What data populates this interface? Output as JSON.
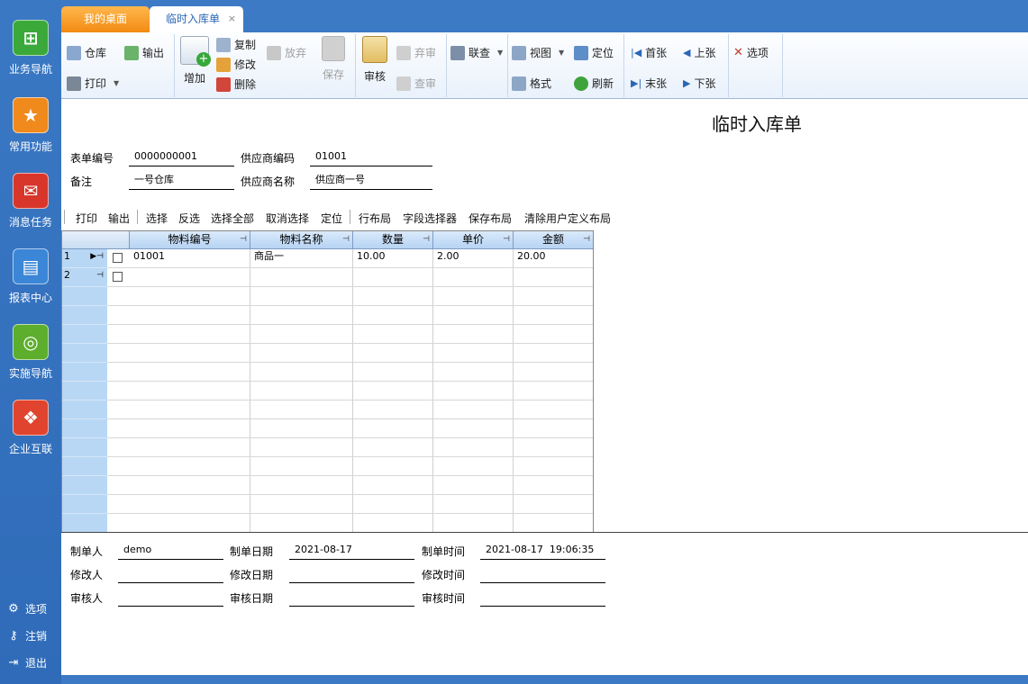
{
  "sidebar": {
    "items": [
      {
        "label": "业务导航",
        "icon": "business-nav-icon",
        "color": "#3aa93a"
      },
      {
        "label": "常用功能",
        "icon": "star-icon",
        "color": "#f08a1c"
      },
      {
        "label": "消息任务",
        "icon": "message-icon",
        "color": "#d9362b"
      },
      {
        "label": "报表中心",
        "icon": "report-icon",
        "color": "#3b86d6"
      },
      {
        "label": "实施导航",
        "icon": "compass-icon",
        "color": "#5cae2c"
      },
      {
        "label": "企业互联",
        "icon": "enterprise-icon",
        "color": "#e0442e"
      }
    ],
    "bottom": [
      {
        "label": "选项",
        "icon": "gear-icon"
      },
      {
        "label": "注销",
        "icon": "key-icon"
      },
      {
        "label": "退出",
        "icon": "exit-icon"
      }
    ]
  },
  "tabs": [
    {
      "label": "我的桌面"
    },
    {
      "label": "临时入库单",
      "close": "×"
    }
  ],
  "toolbar": {
    "warehouse": "仓库",
    "export": "输出",
    "print": "打印",
    "add": "增加",
    "copy": "复制",
    "edit": "修改",
    "delete": "删除",
    "discard": "放弃",
    "save": "保存",
    "audit": "审核",
    "unaudit": "弃审",
    "query_audit": "查审",
    "linked_query": "联查",
    "view": "视图",
    "format": "格式",
    "locate": "定位",
    "refresh": "刷新",
    "first": "首张",
    "prev": "上张",
    "last": "末张",
    "next": "下张",
    "options": "选项"
  },
  "document": {
    "title": "临时入库单",
    "form_no_label": "表单编号",
    "form_no": "0000000001",
    "supplier_code_label": "供应商编码",
    "supplier_code": "01001",
    "remark_label": "备注",
    "remark": "一号仓库",
    "supplier_name_label": "供应商名称",
    "supplier_name": "供应商一号"
  },
  "grid_toolbar": [
    "打印",
    "输出",
    "选择",
    "反选",
    "选择全部",
    "取消选择",
    "定位",
    "行布局",
    "字段选择器",
    "保存布局",
    "清除用户定义布局"
  ],
  "grid": {
    "columns": [
      "物料编号",
      "物料名称",
      "数量",
      "单价",
      "金额"
    ],
    "rows": [
      {
        "no": "1",
        "cells": [
          "01001",
          "商品一",
          "10.00",
          "2.00",
          "20.00"
        ]
      },
      {
        "no": "2",
        "cells": [
          "",
          "",
          "",
          "",
          ""
        ]
      }
    ]
  },
  "footer": {
    "creator_label": "制单人",
    "creator": "demo",
    "create_date_label": "制单日期",
    "create_date": "2021-08-17",
    "create_time_label": "制单时间",
    "create_time": "2021-08-17  19:06:35",
    "modifier_label": "修改人",
    "modify_date_label": "修改日期",
    "modify_time_label": "修改时间",
    "auditor_label": "审核人",
    "audit_date_label": "审核日期",
    "audit_time_label": "审核时间"
  },
  "colors": {
    "accent": "#3d7ac6",
    "tab_active": "#f28a12",
    "grid_header": "#b6d3f3"
  }
}
